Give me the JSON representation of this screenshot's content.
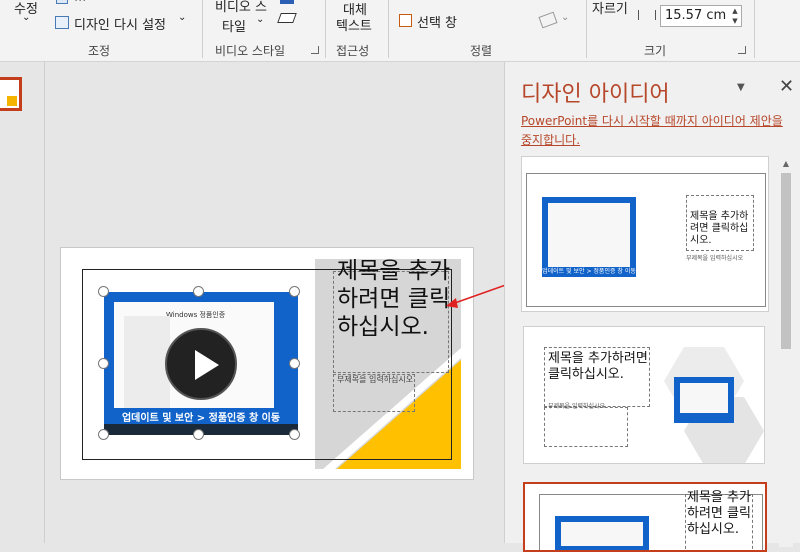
{
  "ribbon": {
    "adjust_group": {
      "edit_label": "수정",
      "edit_arrow": "⌄",
      "clipped_button_label": "...",
      "reset_design_label": "디자인 다시 설정",
      "reset_design_arrow": "⌄",
      "group_label": "조정"
    },
    "video_styles_group": {
      "styles_label_line1": "비디오 스",
      "styles_label_line2": "타일",
      "styles_arrow": "⌄",
      "group_label": "비디오 스타일"
    },
    "accessibility_group": {
      "alt_text_line1": "대체",
      "alt_text_line2": "텍스트",
      "group_label": "접근성"
    },
    "arrange_group": {
      "selection_pane_label": "선택 창",
      "group_label": "정렬"
    },
    "size_group": {
      "crop_label": "자르기",
      "width_value": "15.57 cm",
      "group_label": "크기"
    },
    "icons": {
      "adjust": "adjust-icon",
      "reset": "reset-design-icon",
      "video_styles": "video-styles-icon",
      "eraser": "eraser-icon",
      "selection_pane": "selection-pane-icon",
      "rotate": "rotate-icon",
      "width": "width-icon",
      "dialog_launcher": "dialog-launcher-icon"
    }
  },
  "slide": {
    "title_placeholder": "제목을 추가하려면 클릭하십시오.",
    "subtitle_placeholder": "부제목을 입력하십시오",
    "video_caption": "업데이트 및 보안 > 정품인증 창 이동",
    "video_window_title": "Windows 정품인증",
    "play_icon": "play-icon"
  },
  "design_pane": {
    "title": "디자인 아이디어",
    "dropdown_icon": "▼",
    "close_icon": "✕",
    "restart_link": "PowerPoint를 다시 시작할 때까지 아이디어 제안을 중지합니다.",
    "ideas": [
      {
        "title": "제목을 추가하려면 클릭하십시오.",
        "subtitle": "부제목을 입력하십시오",
        "caption": "업데이트 및 보안 > 정품인증 창 이동"
      },
      {
        "title": "제목을 추가하려면 클릭하십시오.",
        "subtitle": "부제목을 입력하십시오"
      },
      {
        "title": "제목을 추가하려면 클릭하십시오."
      }
    ]
  },
  "colors": {
    "accent": "#b7472a",
    "selection_border": "#c43e1c",
    "video_blue": "#1163c9",
    "triangle_yellow": "#ffc000",
    "arrow_red": "#e02020"
  }
}
